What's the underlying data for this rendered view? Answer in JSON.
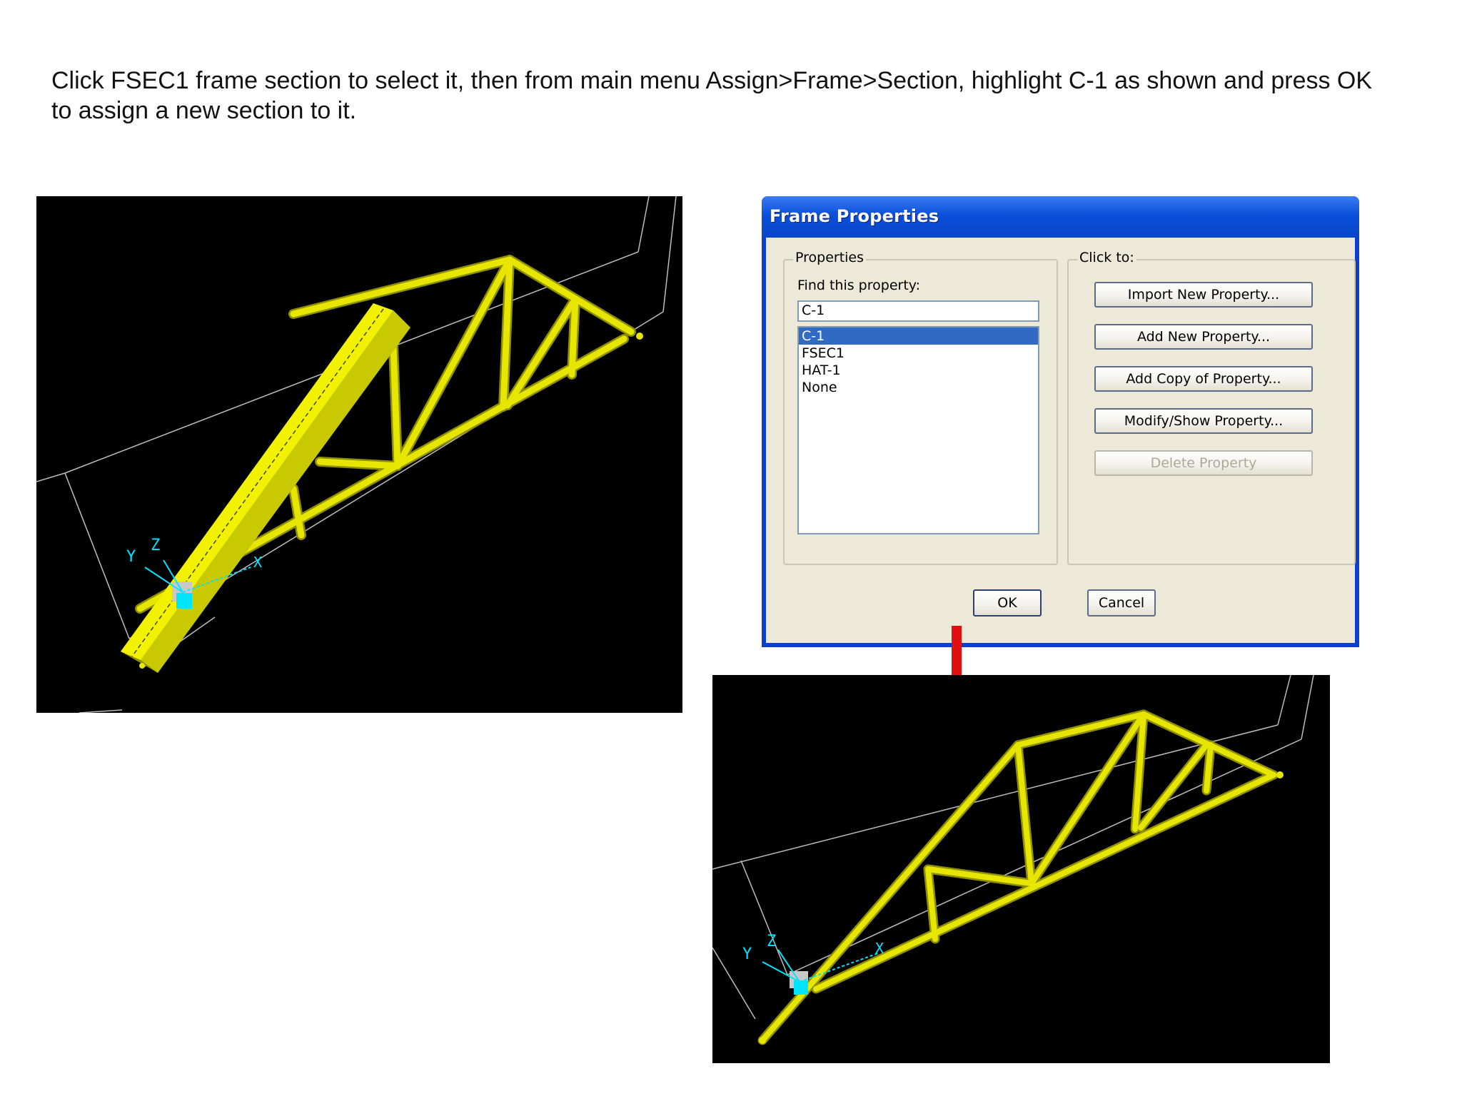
{
  "instructions": "Click FSEC1 frame section to select it, then from main menu Assign>Frame>Section, highlight C-1 as shown and press OK to assign a new section to it.",
  "dialog": {
    "title": "Frame Properties",
    "properties_group_label": "Properties",
    "find_label": "Find this property:",
    "find_value": "C-1",
    "list_items": [
      "C-1",
      "FSEC1",
      "HAT-1",
      "None"
    ],
    "selected_item": "C-1",
    "click_group_label": "Click to:",
    "buttons": {
      "import": "Import New Property...",
      "add_new": "Add New Property...",
      "add_copy": "Add Copy of Property...",
      "modify": "Modify/Show Property...",
      "delete": "Delete Property"
    },
    "ok_label": "OK",
    "cancel_label": "Cancel"
  },
  "axes": {
    "x": "X",
    "y": "Y",
    "z": "Z"
  },
  "colors": {
    "truss": "#e6e600",
    "truss_dark": "#8f8f00",
    "axis": "#00e5ff",
    "arrow": "#e01010",
    "viewport_bg": "#000000"
  }
}
